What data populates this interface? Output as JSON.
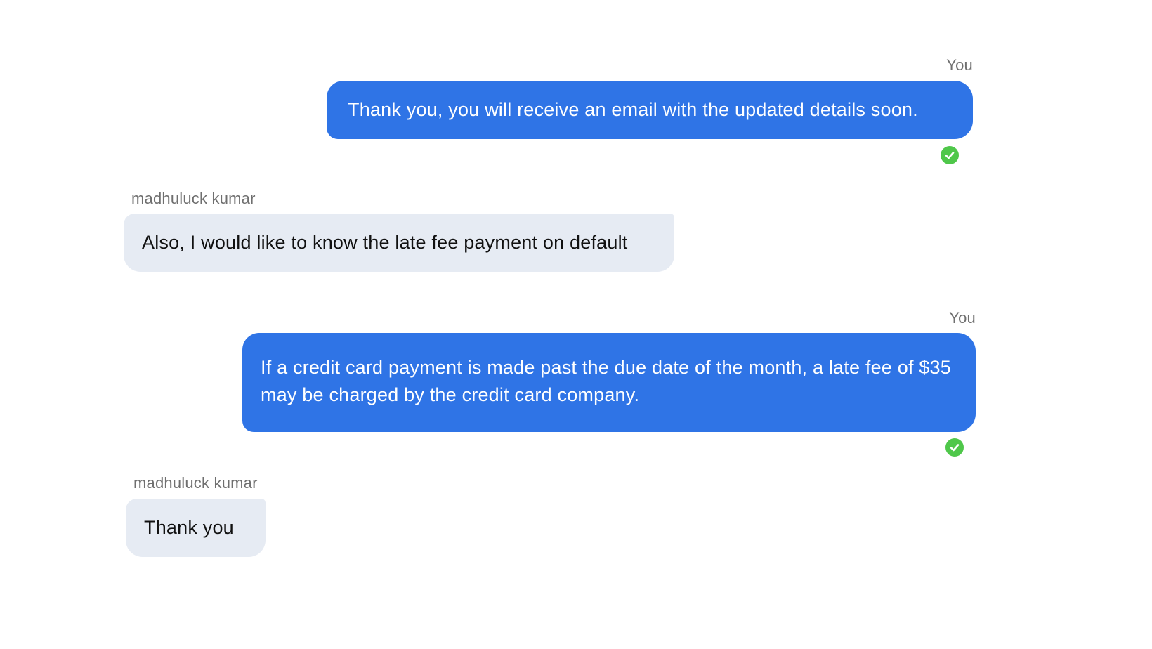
{
  "messages": [
    {
      "direction": "out",
      "sender": "You",
      "text": "Thank you, you will receive an email with the updated details soon.",
      "status_icon": "check-circle-icon",
      "status_color": "#4fc74a"
    },
    {
      "direction": "in",
      "sender": "madhuluck kumar",
      "text": "Also, I would like to know the late fee payment on default"
    },
    {
      "direction": "out",
      "sender": "You",
      "text": "If a credit card payment is made past the due date of the month, a late fee of $35 may be charged by the credit card company.",
      "status_icon": "check-circle-icon",
      "status_color": "#4fc74a"
    },
    {
      "direction": "in",
      "sender": "madhuluck kumar",
      "text": "Thank you"
    }
  ],
  "colors": {
    "outgoing_bubble": "#2f74e6",
    "incoming_bubble": "#e6ebf3",
    "sender_label": "#6f6f6f",
    "read_check": "#4fc74a"
  }
}
